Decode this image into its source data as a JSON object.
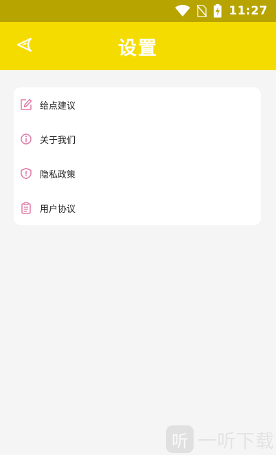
{
  "status_bar": {
    "time": "11:27",
    "icons": [
      "wifi-icon",
      "no-sim-icon",
      "battery-charging-icon"
    ]
  },
  "header": {
    "title": "设置",
    "back_icon": "back-arrow-icon",
    "background_color": "#f5dc00",
    "status_bar_color": "#b8a400"
  },
  "menu": {
    "icon_color": "#e07aa6",
    "items": [
      {
        "label": "给点建议",
        "icon": "edit-icon"
      },
      {
        "label": "关于我们",
        "icon": "info-icon"
      },
      {
        "label": "隐私政策",
        "icon": "shield-icon"
      },
      {
        "label": "用户协议",
        "icon": "clipboard-icon"
      }
    ]
  },
  "watermark": {
    "logo_char": "听",
    "text": "一听下载"
  }
}
